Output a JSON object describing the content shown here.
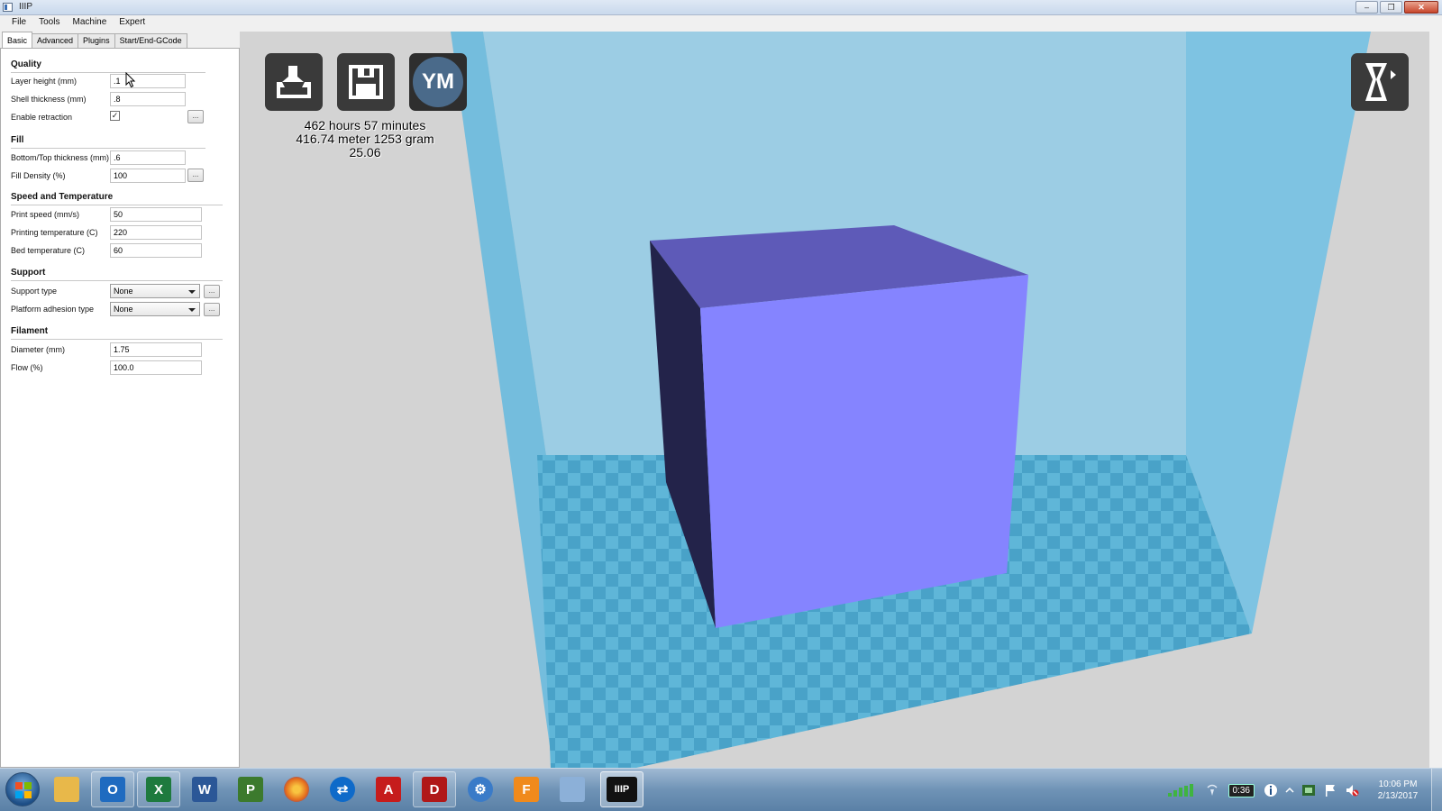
{
  "window": {
    "title": "IIIP",
    "minimize": "‒",
    "restore": "❐",
    "close": "✕"
  },
  "menu": [
    "File",
    "Tools",
    "Machine",
    "Expert"
  ],
  "tabs": [
    {
      "label": "Basic",
      "active": true
    },
    {
      "label": "Advanced",
      "active": false
    },
    {
      "label": "Plugins",
      "active": false
    },
    {
      "label": "Start/End-GCode",
      "active": false
    }
  ],
  "quality": {
    "title": "Quality",
    "layer_height_label": "Layer height (mm)",
    "layer_height_value": ".1",
    "shell_thickness_label": "Shell thickness (mm)",
    "shell_thickness_value": ".8",
    "enable_retraction_label": "Enable retraction",
    "enable_retraction_checked": "✓",
    "more": "..."
  },
  "fill": {
    "title": "Fill",
    "bottom_top_label": "Bottom/Top thickness (mm)",
    "bottom_top_value": ".6",
    "density_label": "Fill Density (%)",
    "density_value": "100",
    "more": "..."
  },
  "speed": {
    "title": "Speed and Temperature",
    "print_speed_label": "Print speed (mm/s)",
    "print_speed_value": "50",
    "print_temp_label": "Printing temperature (C)",
    "print_temp_value": "220",
    "bed_temp_label": "Bed temperature (C)",
    "bed_temp_value": "60"
  },
  "support": {
    "title": "Support",
    "type_label": "Support type",
    "type_value": "None",
    "adhesion_label": "Platform adhesion type",
    "adhesion_value": "None",
    "more": "..."
  },
  "filament": {
    "title": "Filament",
    "diameter_label": "Diameter (mm)",
    "diameter_value": "1.75",
    "flow_label": "Flow (%)",
    "flow_value": "100.0"
  },
  "print_info": {
    "time": "462 hours 57 minutes",
    "material": "416.74 meter 1253 gram",
    "cost": "25.06"
  },
  "toolbar": {
    "ym_label": "YM"
  },
  "taskbar": {
    "apps": [
      {
        "name": "file-explorer",
        "color": "#e8b84a",
        "glyph": ""
      },
      {
        "name": "outlook",
        "color": "#1f6bc0",
        "glyph": "O"
      },
      {
        "name": "excel",
        "color": "#1e7a3e",
        "glyph": "X"
      },
      {
        "name": "word",
        "color": "#2b5797",
        "glyph": "W"
      },
      {
        "name": "project",
        "color": "#3c7a2d",
        "glyph": "P"
      },
      {
        "name": "firefox",
        "color": "#e46b1c",
        "glyph": ""
      },
      {
        "name": "teamviewer",
        "color": "#0e6ac9",
        "glyph": "⇄"
      },
      {
        "name": "acrobat",
        "color": "#c61c1c",
        "glyph": "A"
      },
      {
        "name": "pdf-app",
        "color": "#b01818",
        "glyph": "D"
      },
      {
        "name": "settings",
        "color": "#3a7bc8",
        "glyph": "⚙"
      },
      {
        "name": "f-app",
        "color": "#f08a1c",
        "glyph": "F"
      },
      {
        "name": "notepad",
        "color": "#8cb0d8",
        "glyph": ""
      },
      {
        "name": "iiip",
        "color": "#111111",
        "glyph": "IIIP"
      }
    ],
    "battery": "0:36",
    "time": "10:06 PM",
    "date": "2/13/2017"
  }
}
